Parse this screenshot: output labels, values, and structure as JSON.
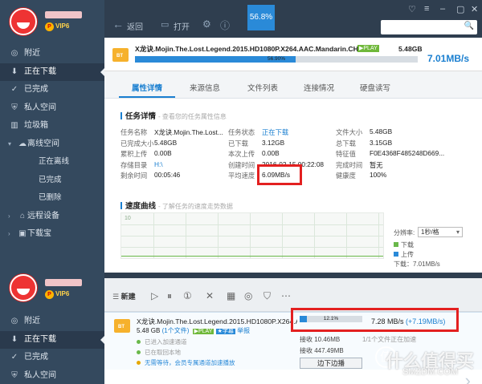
{
  "top": {
    "vip": "VIP6",
    "nav": [
      {
        "label": "附近",
        "icon": "location-icon"
      },
      {
        "label": "正在下载",
        "icon": "download-icon",
        "active": true
      },
      {
        "label": "已完成",
        "icon": "check-icon"
      },
      {
        "label": "私人空间",
        "icon": "lock-icon"
      },
      {
        "label": "垃圾箱",
        "icon": "trash-icon"
      },
      {
        "label": "离线空间",
        "icon": "cloud-icon",
        "expand": "▾"
      },
      {
        "label": "正在离线",
        "sub": true
      },
      {
        "label": "已完成",
        "sub": true
      },
      {
        "label": "已删除",
        "sub": true
      },
      {
        "label": "远程设备",
        "icon": "remote-icon",
        "expand": "›"
      },
      {
        "label": "下载宝",
        "icon": "router-icon",
        "expand": "›"
      }
    ],
    "toolbar": {
      "back": "返回",
      "open": "打开",
      "percent": "56.8%"
    },
    "file": {
      "name": "X龙诀.Mojin.The.Lost.Legend.2015.HD1080P.X264.AAC.Mandarin.CHS-E...",
      "play_badge": "▶PLAY",
      "size": "5.48GB",
      "progress": 56.9,
      "progress_label": "56.90%",
      "speed": "7.01MB/s"
    },
    "tabs": [
      "属性详情",
      "来源信息",
      "文件列表",
      "连接情况",
      "硬盘读写"
    ],
    "details": {
      "title": "任务详情",
      "hint": "- 查看您的任务属性信息",
      "rows": [
        [
          {
            "k": "任务名称",
            "v": "X龙诀.Mojin.The.Lost..."
          },
          {
            "k": "任务状态",
            "v": "正在下载",
            "blue": true
          },
          {
            "k": "文件大小",
            "v": "5.48GB"
          }
        ],
        [
          {
            "k": "已完成大小",
            "v": "5.48GB"
          },
          {
            "k": "已下载",
            "v": "3.12GB"
          },
          {
            "k": "总下载",
            "v": "3.15GB"
          }
        ],
        [
          {
            "k": "累积上传",
            "v": "0.00B"
          },
          {
            "k": "本次上传",
            "v": "0.00B"
          },
          {
            "k": "特征值",
            "v": "F0E4368F485248D669..."
          }
        ],
        [
          {
            "k": "存储目录",
            "v": "H:\\",
            "blue": true
          },
          {
            "k": "创建时间",
            "v": "2016-02-15 00:22:08"
          },
          {
            "k": "完成时间",
            "v": "暂无"
          }
        ],
        [
          {
            "k": "剩余时间",
            "v": "00:05:46"
          },
          {
            "k": "平均速度",
            "v": "6.09MB/s"
          },
          {
            "k": "健康度",
            "v": "100%"
          }
        ]
      ]
    },
    "curve": {
      "title": "速度曲线",
      "hint": "- 了解任务的速度走势数据",
      "axis_label": "10",
      "resolution_label": "分辨率:",
      "resolution_value": "1秒/格",
      "legend_download": "下载",
      "legend_upload": "上传",
      "download_speed": "下载：7.01MB/s",
      "download_color": "#6ab84a",
      "upload_color": "#2a8ad8"
    }
  },
  "bottom": {
    "vip": "VIP6",
    "nav": [
      {
        "label": "附近",
        "icon": "location-icon"
      },
      {
        "label": "正在下载",
        "icon": "download-icon",
        "active": true
      },
      {
        "label": "已完成",
        "icon": "check-icon"
      },
      {
        "label": "私人空间",
        "icon": "lock-icon"
      }
    ],
    "new_label": "新建",
    "task": {
      "name": "X龙诀.Mojin.The.Lost.Legend.2015.HD1080P.X264.AAC.Ma",
      "size": "5.48 GB",
      "files": "(1个文件)",
      "play_badge": "▶PLAY",
      "subtitle_badge": "★字幕",
      "share": "举报",
      "checks": [
        "已进入加速通道",
        "已在取回本地",
        "无需等待，会员专属通道加速播放"
      ],
      "progress": 12.1,
      "progress_label": "12.1%",
      "speed": "7.28   MB/s",
      "speed_extra": "(+7.19MB/s)",
      "recv1": "接收 10.46MB",
      "recv2": "接收 447.49MB",
      "queue": "1/1个文件正在加速",
      "button": "边下边播"
    },
    "watermark_logo": "值",
    "watermark": "什么值得买",
    "watermark_site": "SMZDM.COM"
  }
}
